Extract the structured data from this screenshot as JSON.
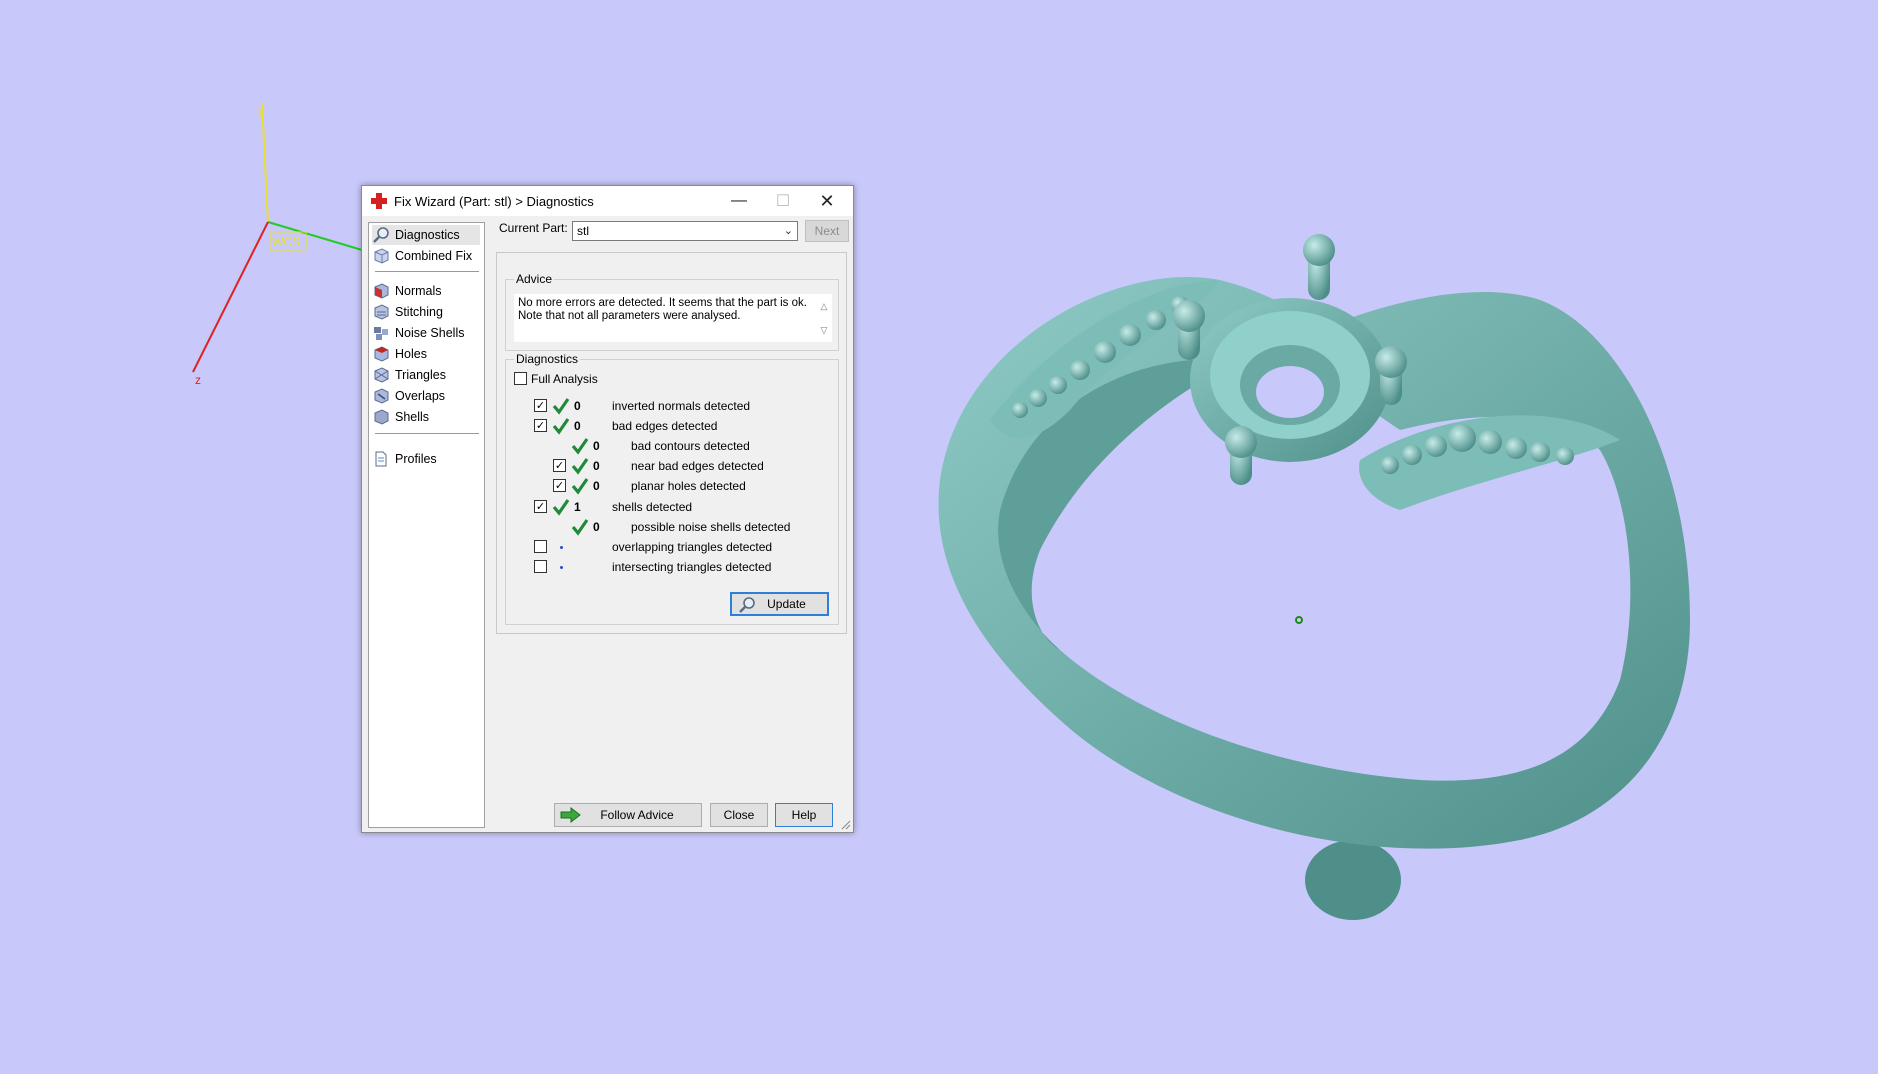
{
  "viewport": {
    "axes": {
      "x_label": "",
      "y_label": "y",
      "z_label": "z",
      "wcs_label": "WCS"
    },
    "colors": {
      "background": "#c8c8fa",
      "model": "#6fb3ae",
      "axis_x": "#22cc22",
      "axis_y": "#e8e030",
      "axis_z": "#dd2222"
    }
  },
  "dialog": {
    "title": "Fix Wizard (Part: stl) > Diagnostics",
    "titlebar_buttons": {
      "minimize": "—",
      "maximize": "☐",
      "close": "✕"
    },
    "nav": {
      "items_top": [
        {
          "label": "Diagnostics",
          "icon": "magnifier-icon",
          "active": true
        },
        {
          "label": "Combined Fix",
          "icon": "cube-icon",
          "active": false
        }
      ],
      "items_mid": [
        {
          "label": "Normals",
          "icon": "normals-cube-icon"
        },
        {
          "label": "Stitching",
          "icon": "stitching-cube-icon"
        },
        {
          "label": "Noise Shells",
          "icon": "noise-shells-icon"
        },
        {
          "label": "Holes",
          "icon": "holes-cube-icon"
        },
        {
          "label": "Triangles",
          "icon": "triangles-icon"
        },
        {
          "label": "Overlaps",
          "icon": "overlaps-icon"
        },
        {
          "label": "Shells",
          "icon": "shells-icon"
        }
      ],
      "items_bottom": [
        {
          "label": "Profiles",
          "icon": "profiles-icon"
        }
      ]
    },
    "current_part": {
      "label": "Current Part:",
      "value": "stl",
      "next_label": "Next"
    },
    "advice": {
      "group_label": "Advice",
      "text_line1": "No more errors are detected. It seems that the part is ok.",
      "text_line2": "Note that not all parameters were analysed."
    },
    "diagnostics": {
      "group_label": "Diagnostics",
      "full_analysis_label": "Full Analysis",
      "full_analysis_checked": false,
      "rows": [
        {
          "checkbox": true,
          "checked": true,
          "status": "ok",
          "value": "0",
          "label": "inverted normals detected",
          "indent": 0
        },
        {
          "checkbox": true,
          "checked": true,
          "status": "ok",
          "value": "0",
          "label": "bad edges detected",
          "indent": 0
        },
        {
          "checkbox": false,
          "checked": false,
          "status": "ok",
          "value": "0",
          "label": "bad contours detected",
          "indent": 1
        },
        {
          "checkbox": true,
          "checked": true,
          "status": "ok",
          "value": "0",
          "label": "near bad edges detected",
          "indent": 1
        },
        {
          "checkbox": true,
          "checked": true,
          "status": "ok",
          "value": "0",
          "label": "planar holes detected",
          "indent": 1
        },
        {
          "checkbox": true,
          "checked": true,
          "status": "ok",
          "value": "1",
          "label": "shells detected",
          "indent": 0
        },
        {
          "checkbox": false,
          "checked": false,
          "status": "ok",
          "value": "0",
          "label": "possible noise shells detected",
          "indent": 1
        },
        {
          "checkbox": true,
          "checked": false,
          "status": "none",
          "value": "",
          "label": "overlapping triangles detected",
          "indent": 0
        },
        {
          "checkbox": true,
          "checked": false,
          "status": "none",
          "value": "",
          "label": "intersecting triangles detected",
          "indent": 0
        }
      ],
      "update_label": "Update"
    },
    "buttons": {
      "follow_advice": "Follow Advice",
      "close": "Close",
      "help": "Help"
    }
  }
}
